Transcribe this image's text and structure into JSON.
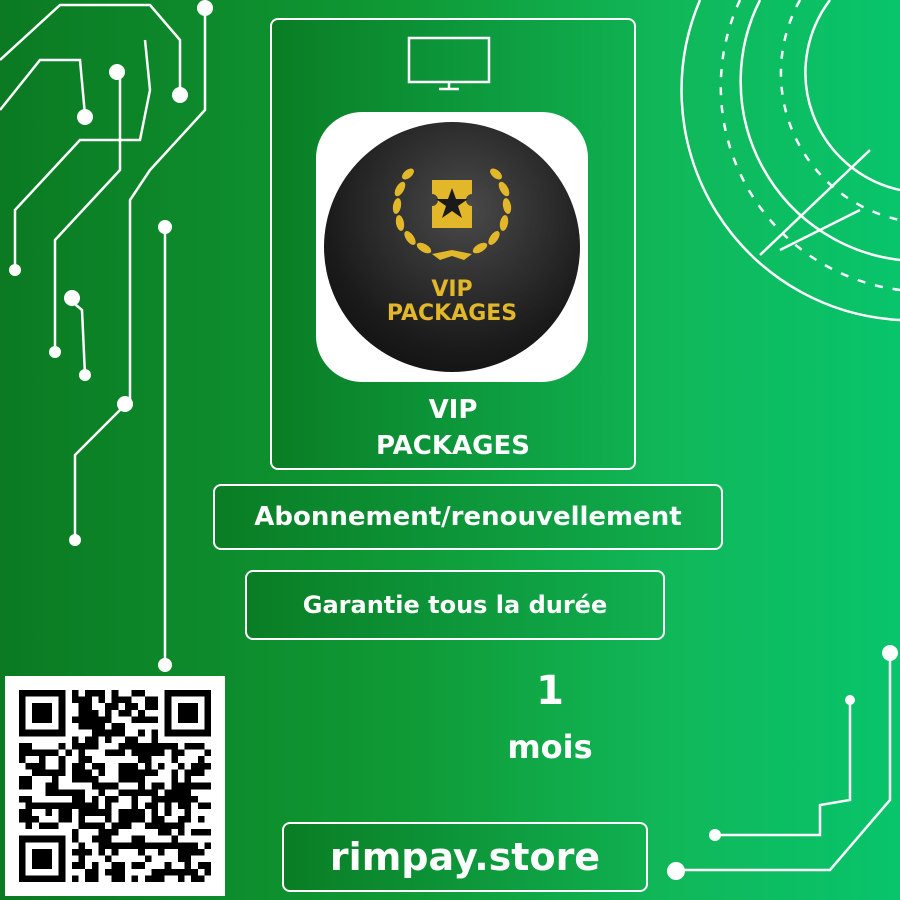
{
  "logo": {
    "line1": "VIP",
    "line2": "PACKAGES",
    "gold": "#e2b72a",
    "icon": "laurel-ticket-star-icon"
  },
  "card": {
    "title_line1": "VIP",
    "title_line2": "PACKAGES",
    "icon": "tv-icon"
  },
  "badges": {
    "subscription": "Abonnement/renouvellement",
    "guarantee": "Garantie tous la durée"
  },
  "duration": {
    "number": "1",
    "unit": "mois"
  },
  "store": {
    "url": "rimpay.store"
  },
  "qr": {
    "icon": "qr-code-icon"
  },
  "colors": {
    "bg_dark": "#0b7a22",
    "bg_light": "#08c46b",
    "accent": "#ffffff"
  }
}
